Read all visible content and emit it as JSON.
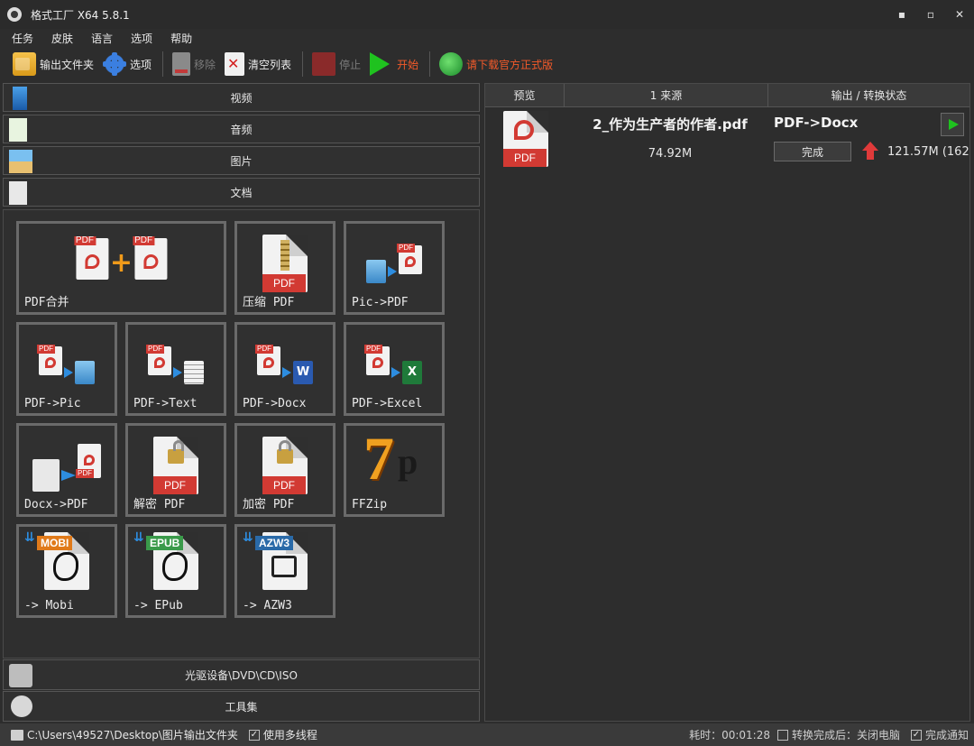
{
  "window": {
    "title": "格式工厂 X64 5.8.1",
    "controls": {
      "minimize": "▪",
      "maximize": "▫",
      "close": "✕"
    }
  },
  "menu": {
    "items": [
      "任务",
      "皮肤",
      "语言",
      "选项",
      "帮助"
    ]
  },
  "toolbar": {
    "output_folder": "输出文件夹",
    "options": "选项",
    "remove": "移除",
    "clear_list": "清空列表",
    "stop": "停止",
    "start": "开始",
    "download_official": "请下载官方正式版"
  },
  "categories": {
    "video": "视频",
    "audio": "音频",
    "image": "图片",
    "document": "文档",
    "disc": "光驱设备\\DVD\\CD\\ISO",
    "tools": "工具集"
  },
  "tiles": {
    "pdf_merge": "PDF合并",
    "compress_pdf": "压缩 PDF",
    "pic_to_pdf": "Pic->PDF",
    "pdf_to_pic": "PDF->Pic",
    "pdf_to_text": "PDF->Text",
    "pdf_to_docx": "PDF->Docx",
    "pdf_to_excel": "PDF->Excel",
    "docx_to_pdf": "Docx->PDF",
    "decrypt_pdf": "解密 PDF",
    "encrypt_pdf": "加密 PDF",
    "ffzip": "FFZip",
    "to_mobi": "-> Mobi",
    "to_epub": "-> EPub",
    "to_azw3": "-> AZW3"
  },
  "icon_text": {
    "pdf": "PDF",
    "mobi": "MOBI",
    "epub": "EPUB",
    "azw3": "AZW3",
    "w": "W",
    "x": "X",
    "zip7": "7",
    "zip_p": "p"
  },
  "task_list": {
    "headers": {
      "preview": "预览",
      "source": "1 来源",
      "status": "输出 / 转换状态"
    },
    "rows": [
      {
        "file_name": "2_作为生产者的作者.pdf",
        "size": "74.92M",
        "conversion": "PDF->Docx",
        "status": "完成",
        "output_size": "121.57M  (162"
      }
    ]
  },
  "statusbar": {
    "path": "C:\\Users\\49527\\Desktop\\图片输出文件夹",
    "multithread": "使用多线程",
    "elapsed": "耗时：00:01:28",
    "after_convert": "转换完成后：关闭电脑",
    "complete_notify": "完成通知"
  },
  "colors": {
    "background": "#2d2d2d",
    "pdf_red": "#d23a33",
    "start_green": "#1fc21f",
    "accent_orange": "#f35a2a"
  }
}
